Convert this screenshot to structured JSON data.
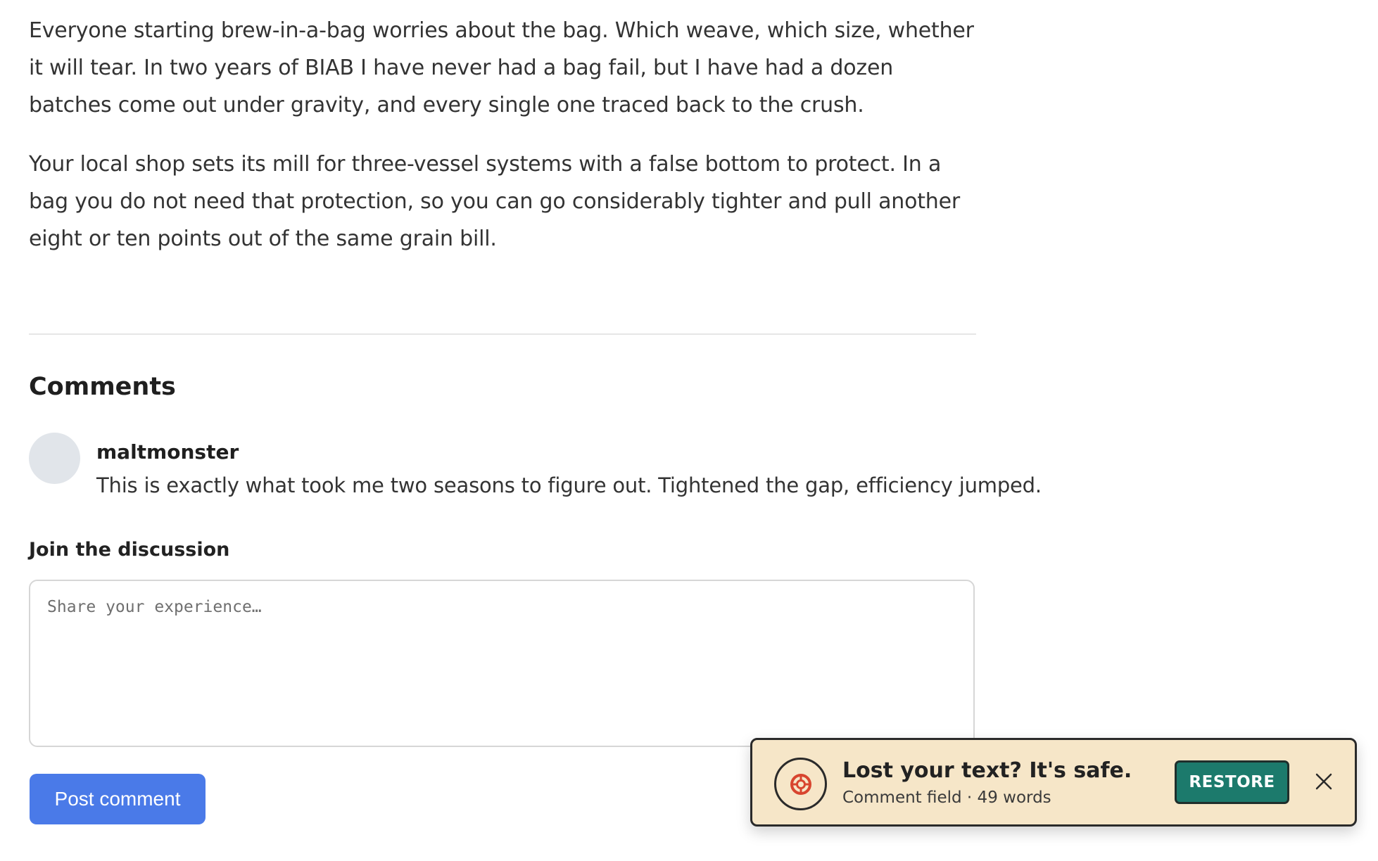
{
  "article": {
    "paragraphs": [
      "Everyone starting brew-in-a-bag worries about the bag. Which weave, which size, whether it will tear. In two years of BIAB I have never had a bag fail, but I have had a dozen batches come out under gravity, and every single one traced back to the crush.",
      "Your local shop sets its mill for three-vessel systems with a false bottom to protect. In a bag you do not need that protection, so you can go considerably tighter and pull another eight or ten points out of the same grain bill."
    ]
  },
  "comments": {
    "heading": "Comments",
    "items": [
      {
        "author": "maltmonster",
        "body": "This is exactly what took me two seasons to figure out. Tightened the gap, efficiency jumped."
      }
    ],
    "join_label": "Join the discussion",
    "input_placeholder": "Share your experience…",
    "input_value": "",
    "post_label": "Post comment"
  },
  "toast": {
    "title": "Lost your text? It's safe.",
    "subtitle": "Comment field · 49 words",
    "restore_label": "RESTORE",
    "icon": "lifebuoy-icon",
    "close_icon": "close-icon"
  },
  "colors": {
    "accent": "#4a7ae8",
    "toast_bg": "#f6e6c8",
    "restore_bg": "#1c7a6c",
    "icon_red": "#d8452f"
  }
}
